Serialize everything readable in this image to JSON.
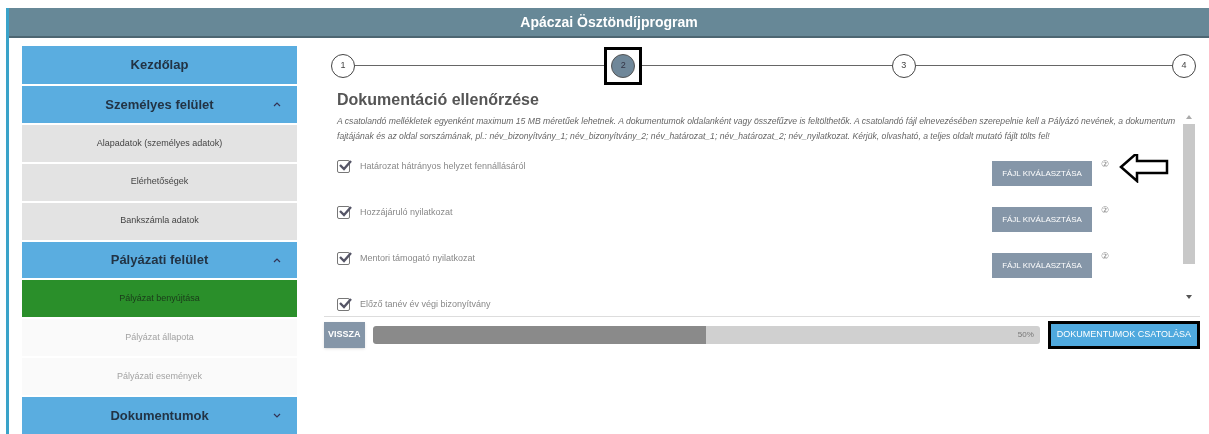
{
  "window": {
    "title": "Apáczai Ösztöndíjprogram"
  },
  "sidebar": {
    "items": [
      {
        "kind": "page",
        "label": "Kezdőlap"
      },
      {
        "kind": "section",
        "label": "Személyes felület",
        "expanded": true
      },
      {
        "kind": "link",
        "label": "Alapadatok (személyes adatok)",
        "selected": false,
        "disabled": false
      },
      {
        "kind": "link",
        "label": "Elérhetőségek",
        "selected": false,
        "disabled": false
      },
      {
        "kind": "link",
        "label": "Bankszámla adatok",
        "selected": false,
        "disabled": false
      },
      {
        "kind": "section",
        "label": "Pályázati felület",
        "expanded": true
      },
      {
        "kind": "link",
        "label": "Pályázat benyújtása",
        "selected": true,
        "disabled": false
      },
      {
        "kind": "link",
        "label": "Pályázat állapota",
        "selected": false,
        "disabled": true
      },
      {
        "kind": "link",
        "label": "Pályázati események",
        "selected": false,
        "disabled": true
      },
      {
        "kind": "section",
        "label": "Dokumentumok",
        "expanded": false
      }
    ]
  },
  "steps": [
    {
      "label": "1",
      "selected": false
    },
    {
      "label": "2",
      "selected": true
    },
    {
      "label": "3",
      "selected": false
    },
    {
      "label": "4",
      "selected": false
    }
  ],
  "section_title": "Dokumentáció ellenőrzése",
  "instructions": "A csatolandó mellékletek egyenként maximum 15 MB méretűek lehetnek. A dokumentumok oldalanként vagy összefűzve is feltölthetők. A csatolandó fájl elnevezésében szerepelnie kell a Pályázó nevének, a dokumentum fajtájának és az oldal sorszámának, pl.: név_bizonyítvány_1; név_bizonyítvány_2; név_határozat_1; név_határozat_2; név_nyilatkozat. Kérjük, olvasható, a teljes oldalt mutató fájlt tölts fel!",
  "documents": [
    {
      "label": "Határozat hátrányos helyzet fennállásáról",
      "checked": true,
      "button": "FÁJL KIVÁLASZTÁSA",
      "help": "②",
      "pointed": true
    },
    {
      "label": "Hozzájáruló nyilatkozat",
      "checked": true,
      "button": "FÁJL KIVÁLASZTÁSA",
      "help": "②",
      "pointed": false
    },
    {
      "label": "Mentori támogató nyilatkozat",
      "checked": true,
      "button": "FÁJL KIVÁLASZTÁSA",
      "help": "②",
      "pointed": false
    },
    {
      "label": "Előző tanév év végi bizonyítvány",
      "checked": true,
      "pointed": false
    }
  ],
  "footer": {
    "back": "VISSZA",
    "progress": {
      "level": 0.5,
      "reading": "50%"
    },
    "submit": "DOKUMENTUMOK CSATOLÁSA"
  }
}
